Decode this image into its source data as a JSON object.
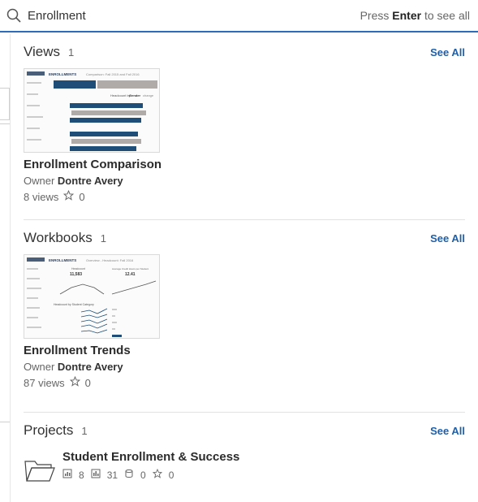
{
  "search": {
    "query": "Enrollment",
    "hint_prefix": "Press",
    "hint_key": "Enter",
    "hint_suffix": "to see all"
  },
  "views": {
    "title": "Views",
    "count": "1",
    "see_all": "See All",
    "item": {
      "thumb_header": "ENROLLMENTS",
      "thumb_subtitle": "Comparison: Fall 2015 and Fall 2016",
      "thumb_caption_a": "Headcount by",
      "thumb_caption_b": "Gender",
      "thumb_caption_c": "change",
      "title": "Enrollment Comparison",
      "owner_label": "Owner",
      "owner_name": "Dontre Avery",
      "views": "8 views",
      "favorites": "0"
    }
  },
  "workbooks": {
    "title": "Workbooks",
    "count": "1",
    "see_all": "See All",
    "item": {
      "thumb_header": "ENROLLMENTS",
      "thumb_subtitle": "Overview - Headcount: Fall 2016",
      "thumb_kpi1_label": "Headcount",
      "thumb_kpi1_value": "11,583",
      "thumb_kpi2_label": "Average Credit Hours per Student",
      "thumb_kpi2_value": "12.41",
      "thumb_section": "Headcount by Student Category",
      "title": "Enrollment Trends",
      "owner_label": "Owner",
      "owner_name": "Dontre Avery",
      "views": "87 views",
      "favorites": "0"
    }
  },
  "projects": {
    "title": "Projects",
    "count": "1",
    "see_all": "See All",
    "item": {
      "title": "Student Enrollment & Success",
      "workbooks": "8",
      "views": "31",
      "datasources": "0",
      "favorites": "0"
    }
  }
}
